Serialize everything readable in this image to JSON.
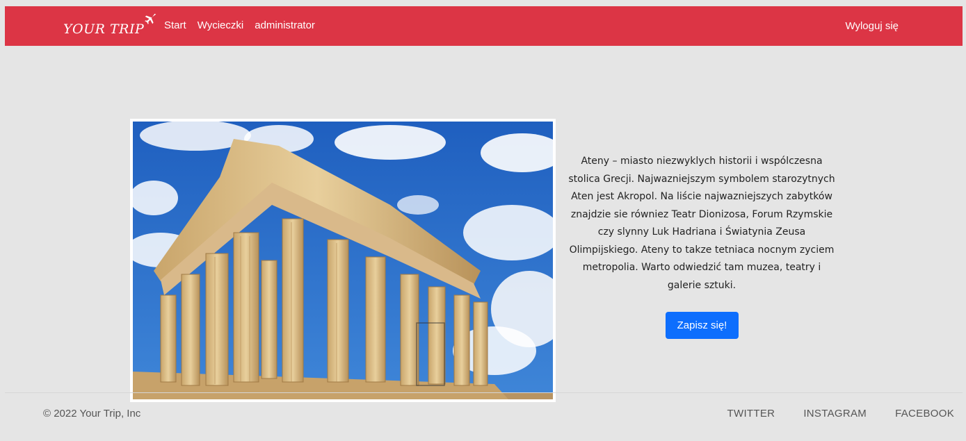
{
  "navbar": {
    "brand": "YOUR TRIP",
    "brand_icon": "airplane-icon",
    "links": [
      "Start",
      "Wycieczki",
      "administrator"
    ],
    "logout": "Wyloguj się",
    "color": "#dc3545"
  },
  "main": {
    "image_alt": "Parthenon, Athens",
    "description": "Ateny – miasto niezwyklych historii i wspólczesna stolica Grecji. Najwazniejszym symbolem starozytnych Aten jest Akropol. Na liście najwazniejszych zabytków znajdzie sie równiez Teatr Dionizosa, Forum Rzymskie czy slynny Luk Hadriana i Światynia Zeusa Olimpijskiego. Ateny to takze tetniaca nocnym zyciem metropolia. Warto odwiedzić tam muzea, teatry i galerie sztuki.",
    "signup_button": "Zapisz się!",
    "button_color": "#0d6efd"
  },
  "footer": {
    "copyright": "© 2022 Your Trip, Inc",
    "social": [
      "TWITTER",
      "INSTAGRAM",
      "FACEBOOK"
    ]
  }
}
